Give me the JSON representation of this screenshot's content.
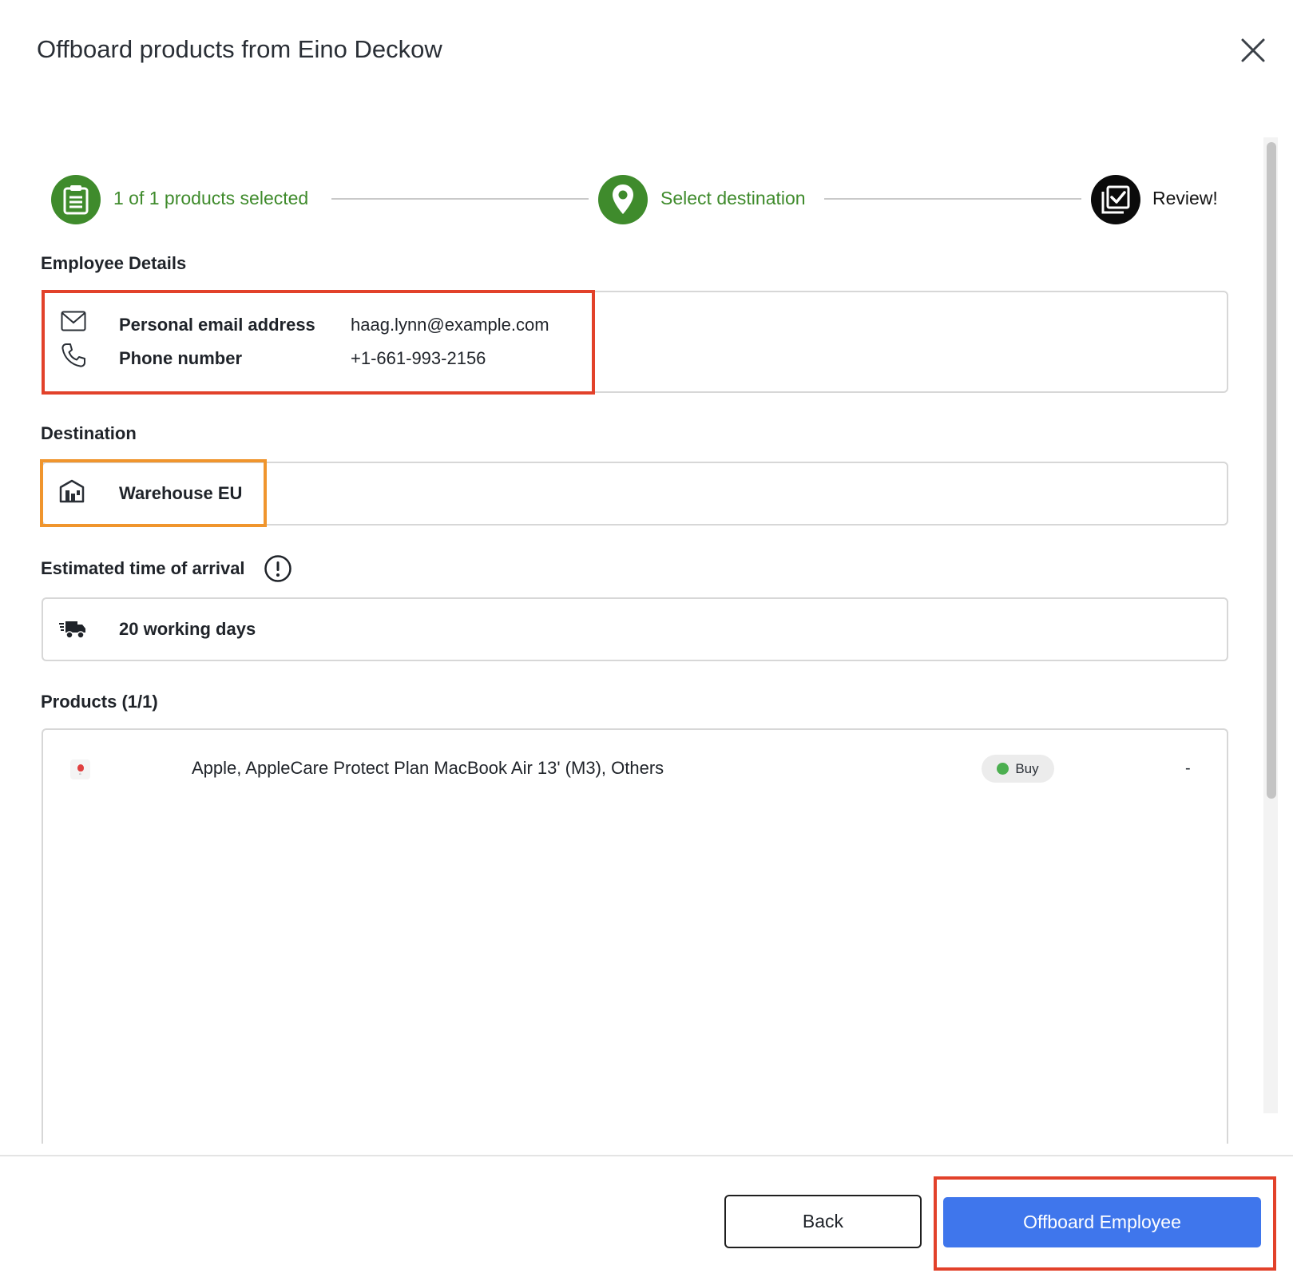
{
  "dialog": {
    "title": "Offboard products from Eino Deckow",
    "close_icon": "close-icon"
  },
  "stepper": {
    "steps": [
      {
        "label": "1 of 1 products selected",
        "icon": "clipboard-icon",
        "state": "completed"
      },
      {
        "label": "Select destination",
        "icon": "location-pin-icon",
        "state": "completed"
      },
      {
        "label": "Review!",
        "icon": "review-check-icon",
        "state": "current"
      }
    ]
  },
  "employee_details": {
    "heading": "Employee Details",
    "rows": [
      {
        "icon": "mail-icon",
        "label": "Personal email address",
        "value": "haag.lynn@example.com"
      },
      {
        "icon": "phone-icon",
        "label": "Phone number",
        "value": "+1-661-993-2156"
      }
    ]
  },
  "destination": {
    "heading": "Destination",
    "icon": "warehouse-icon",
    "value": "Warehouse EU"
  },
  "eta": {
    "heading": "Estimated time of arrival",
    "info_icon": "info-icon",
    "icon": "delivery-truck-icon",
    "value": "20 working days"
  },
  "products": {
    "heading": "Products (1/1)",
    "items": [
      {
        "name": "Apple, AppleCare Protect Plan MacBook Air 13' (M3), Others",
        "badge": "Buy",
        "badge_color": "#4caf50",
        "extra": "-"
      }
    ]
  },
  "footer": {
    "back_label": "Back",
    "primary_label": "Offboard Employee"
  },
  "colors": {
    "accent_green": "#3f8b2c",
    "primary_blue": "#3f76ec",
    "highlight_red": "#e2412a",
    "highlight_orange": "#f0952d"
  }
}
